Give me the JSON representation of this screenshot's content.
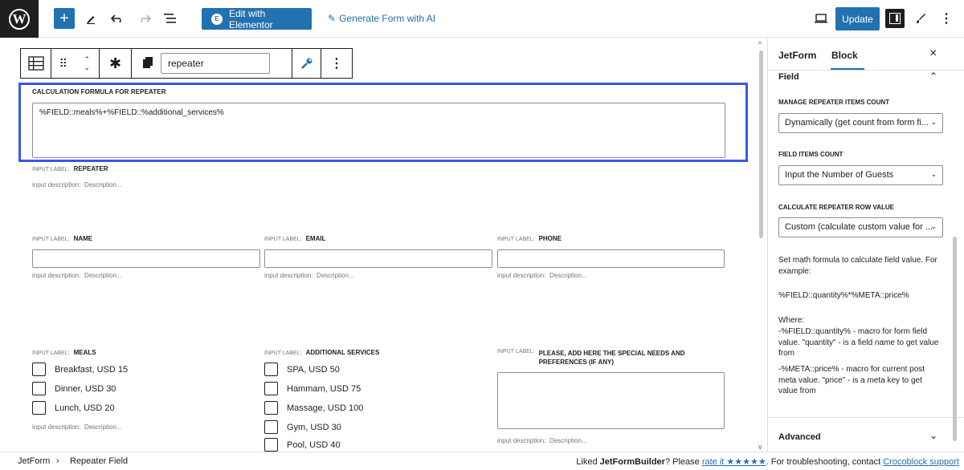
{
  "topbar": {
    "elementor_label": "Edit with Elementor",
    "genai_label": "Generate Form with AI",
    "update_label": "Update"
  },
  "block_toolbar": {
    "input_value": "repeater"
  },
  "formula": {
    "heading": "CALCULATION FORMULA FOR REPEATER",
    "value": "%FIELD::meals%+%FIELD::%additional_services%"
  },
  "captions": {
    "input_label": "INPUT LABEL:",
    "input_description": "input description:",
    "description_placeholder": "Description..."
  },
  "repeater": {
    "label": "REPEATER"
  },
  "fields_row1": [
    {
      "label": "NAME"
    },
    {
      "label": "EMAIL"
    },
    {
      "label": "PHONE"
    }
  ],
  "meals": {
    "label": "MEALS",
    "options": [
      "Breakfast, USD 15",
      "Dinner, USD 30",
      "Lunch, USD 20"
    ]
  },
  "services": {
    "label": "ADDITIONAL SERVICES",
    "options": [
      "SPA, USD 50",
      "Hammam, USD 75",
      "Massage, USD 100",
      "Gym, USD 30",
      "Pool, USD 40"
    ]
  },
  "special": {
    "label": "PLEASE, ADD HERE THE SPECIAL NEEDS AND PREFERENCES (IF ANY)"
  },
  "sidebar": {
    "tabs": [
      "JetForm",
      "Block"
    ],
    "active_tab": "Block",
    "panel_title": "Field",
    "manage_label": "MANAGE REPEATER ITEMS COUNT",
    "manage_value": "Dynamically (get count from form fi...",
    "count_label": "FIELD ITEMS COUNT",
    "count_value": "Input the Number of Guests",
    "calc_label": "CALCULATE REPEATER ROW VALUE",
    "calc_value": "Custom (calculate custom value for ...",
    "help_intro": "Set math formula to calculate field value. For example:",
    "help_example": "%FIELD::quantity%*%META::price%",
    "help_where": "Where:",
    "help_line1": "-%FIELD::quantity% - macro for form field value. \"quantity\" - is a field name to get value from",
    "help_line2": "-%META::price% - macro for current post meta value. \"price\" - is a meta key to get value from",
    "advanced_label": "Advanced"
  },
  "footer": {
    "crumb1": "JetForm",
    "crumb2": "Repeater Field",
    "notice_prefix": "Liked",
    "notice_brand": "JetFormBuilder",
    "notice_mid": "? Please",
    "rate_link": "rate it ★★★★★",
    "notice_suffix": ". For troubleshooting, contact",
    "support_link": "Crocoblock support"
  },
  "colors": {
    "accent": "#2271b1",
    "selection": "#3858e9",
    "dark": "#1e1e1e"
  }
}
